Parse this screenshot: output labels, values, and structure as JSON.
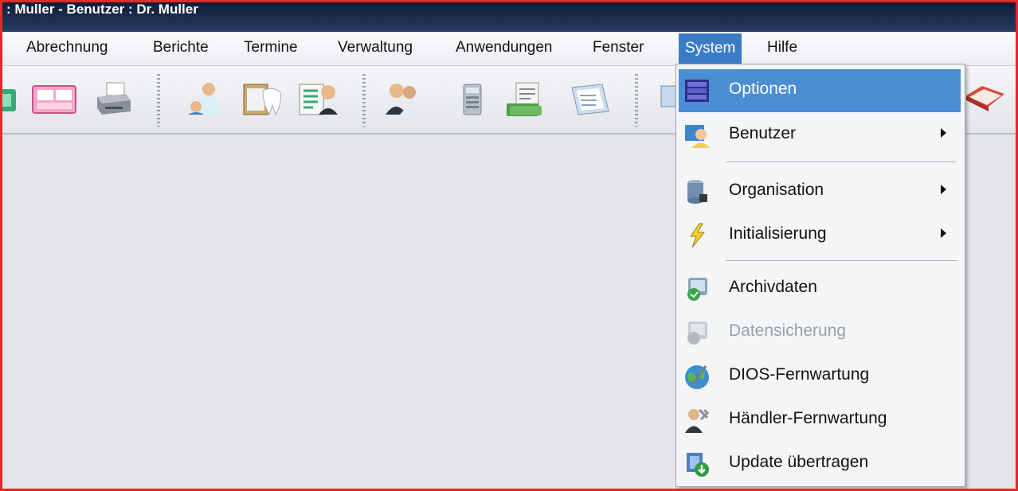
{
  "window": {
    "title": ": Muller - Benutzer : Dr. Muller"
  },
  "menubar": {
    "items": [
      {
        "label": "Abrechnung"
      },
      {
        "label": "Berichte"
      },
      {
        "label": "Termine"
      },
      {
        "label": "Verwaltung"
      },
      {
        "label": "Anwendungen"
      },
      {
        "label": "Fenster"
      },
      {
        "label": "System"
      },
      {
        "label": "Hilfe"
      }
    ],
    "active": "System"
  },
  "toolbar": {
    "icons": [
      "contacts-icon",
      "calendar-icon",
      "printer-icon",
      "dentist-patient-icon",
      "dental-chart-icon",
      "clipboard-doctor-icon",
      "patients-icon",
      "calculator-icon",
      "money-invoice-icon",
      "documents-icon",
      "monitor-icon",
      "book-icon"
    ]
  },
  "system_menu": {
    "items": [
      {
        "label": "Optionen",
        "icon": "options-icon",
        "submenu": false,
        "enabled": true,
        "selected": true
      },
      {
        "label": "Benutzer",
        "icon": "user-icon",
        "submenu": true,
        "enabled": true
      },
      {
        "label": "Organisation",
        "icon": "database-icon",
        "submenu": true,
        "enabled": true
      },
      {
        "label": "Initialisierung",
        "icon": "lightning-icon",
        "submenu": true,
        "enabled": true
      },
      {
        "label": "Archivdaten",
        "icon": "archive-icon",
        "submenu": false,
        "enabled": true
      },
      {
        "label": "Datensicherung",
        "icon": "backup-icon",
        "submenu": false,
        "enabled": false
      },
      {
        "label": "DIOS-Fernwartung",
        "icon": "remote-globe-icon",
        "submenu": false,
        "enabled": true
      },
      {
        "label": "Händler-Fernwartung",
        "icon": "dealer-tools-icon",
        "submenu": false,
        "enabled": true
      },
      {
        "label": "Update übertragen",
        "icon": "update-icon",
        "submenu": false,
        "enabled": true
      }
    ]
  },
  "colors": {
    "frame": "#e12b2b",
    "highlight": "#4a8ed4",
    "title_bar": "#1a2746"
  }
}
